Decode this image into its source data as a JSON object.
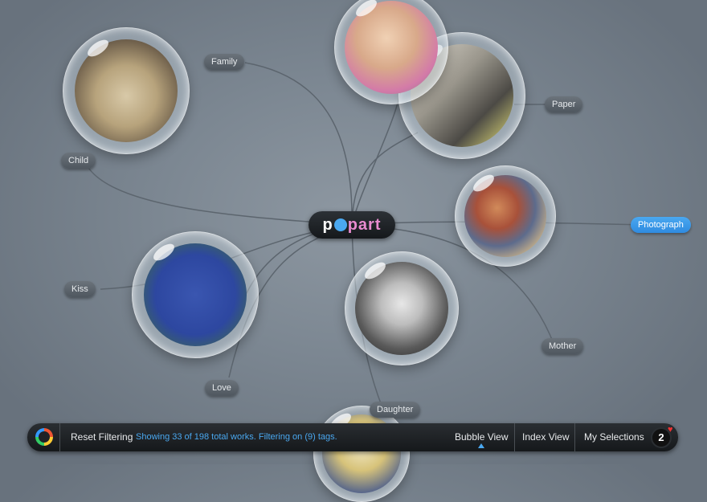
{
  "logo": {
    "prefix": "p",
    "suffix": "part"
  },
  "tags": [
    {
      "id": "family",
      "label": "Family",
      "active": false
    },
    {
      "id": "child",
      "label": "Child",
      "active": false
    },
    {
      "id": "paper",
      "label": "Paper",
      "active": false
    },
    {
      "id": "photograph",
      "label": "Photograph",
      "active": true
    },
    {
      "id": "kiss",
      "label": "Kiss",
      "active": false
    },
    {
      "id": "mother",
      "label": "Mother",
      "active": false
    },
    {
      "id": "love",
      "label": "Love",
      "active": false
    },
    {
      "id": "daughter",
      "label": "Daughter",
      "active": false
    }
  ],
  "bubbles": [
    {
      "id": "dog",
      "icon": "dog-photo-icon"
    },
    {
      "id": "woman-pink",
      "icon": "pinup-woman-icon"
    },
    {
      "id": "interior",
      "icon": "interior-photo-icon"
    },
    {
      "id": "abstract",
      "icon": "abstract-painting-icon"
    },
    {
      "id": "dancers",
      "icon": "dancers-painting-icon"
    },
    {
      "id": "portrait",
      "icon": "portrait-photo-icon"
    },
    {
      "id": "bottom",
      "icon": "painting-icon"
    }
  ],
  "toolbar": {
    "reset_label": "Reset Filtering",
    "status": "Showing 33 of 198 total works. Filtering on (9) tags.",
    "bubble_view": "Bubble View",
    "index_view": "Index View",
    "my_selections": "My Selections",
    "selection_count": "2",
    "active_view": "bubble"
  },
  "colors": {
    "accent": "#4aa8f0",
    "logo_pink": "#e88bd0",
    "toolbar": "#1e2226"
  }
}
